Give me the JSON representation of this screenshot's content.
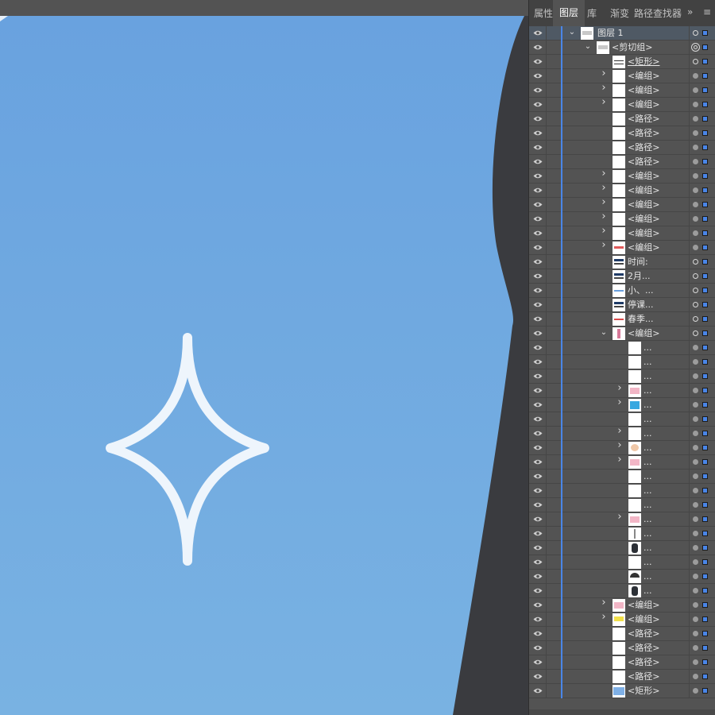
{
  "colors": {
    "canvas_dark": "#3a3b3f",
    "art_top": "#69a2df",
    "art_bottom": "#79b2e2",
    "star": "#eef5fc",
    "panel_bg": "#535353",
    "tab_bar_bg": "#424242",
    "selected_row": "#4f5964",
    "layer_color": "#4a86e8"
  },
  "canvas": {
    "star_icon": "four-point-star-outline"
  },
  "panel": {
    "tabs": [
      {
        "label": "属性",
        "active": false
      },
      {
        "label": "图层",
        "active": true
      },
      {
        "label": "库",
        "active": false
      },
      {
        "label": "渐变",
        "active": false
      },
      {
        "label": "路径查找器",
        "active": false
      }
    ],
    "overflow_glyph": "»",
    "menu_glyph": "≡",
    "rows": [
      {
        "indent": 0,
        "twisty": "open",
        "label": "图层 1",
        "thumb": "layer",
        "target": "outline",
        "selected": true
      },
      {
        "indent": 1,
        "twisty": "open",
        "label": "<剪切组>",
        "thumb": "layer",
        "target": "double"
      },
      {
        "indent": 2,
        "twisty": "",
        "label": "<矩形>",
        "thumb": "rect-line",
        "target": "outline",
        "underline": true
      },
      {
        "indent": 2,
        "twisty": "closed",
        "label": "<编组>",
        "thumb": "blank",
        "target": "fill"
      },
      {
        "indent": 2,
        "twisty": "closed",
        "label": "<编组>",
        "thumb": "blank",
        "target": "fill"
      },
      {
        "indent": 2,
        "twisty": "closed",
        "label": "<编组>",
        "thumb": "blank",
        "target": "fill"
      },
      {
        "indent": 2,
        "twisty": "",
        "label": "<路径>",
        "thumb": "blank",
        "target": "fill"
      },
      {
        "indent": 2,
        "twisty": "",
        "label": "<路径>",
        "thumb": "blank",
        "target": "fill"
      },
      {
        "indent": 2,
        "twisty": "",
        "label": "<路径>",
        "thumb": "blank",
        "target": "fill"
      },
      {
        "indent": 2,
        "twisty": "",
        "label": "<路径>",
        "thumb": "blank",
        "target": "fill"
      },
      {
        "indent": 2,
        "twisty": "closed",
        "label": "<编组>",
        "thumb": "blank",
        "target": "fill"
      },
      {
        "indent": 2,
        "twisty": "closed",
        "label": "<编组>",
        "thumb": "blank",
        "target": "fill"
      },
      {
        "indent": 2,
        "twisty": "closed",
        "label": "<编组>",
        "thumb": "blank",
        "target": "fill"
      },
      {
        "indent": 2,
        "twisty": "closed",
        "label": "<编组>",
        "thumb": "blank",
        "target": "fill"
      },
      {
        "indent": 2,
        "twisty": "closed",
        "label": "<编组>",
        "thumb": "blank",
        "target": "fill"
      },
      {
        "indent": 2,
        "twisty": "closed",
        "label": "<编组>",
        "thumb": "red-mark",
        "target": "fill"
      },
      {
        "indent": 2,
        "twisty": "",
        "label": "时间:",
        "thumb": "dark-text",
        "target": "outline"
      },
      {
        "indent": 2,
        "twisty": "",
        "label": "2月...",
        "thumb": "dark-text",
        "target": "outline"
      },
      {
        "indent": 2,
        "twisty": "",
        "label": "小、...",
        "thumb": "blue-text",
        "target": "outline"
      },
      {
        "indent": 2,
        "twisty": "",
        "label": "停课...",
        "thumb": "dark-text",
        "target": "outline"
      },
      {
        "indent": 2,
        "twisty": "",
        "label": "春季...",
        "thumb": "red-text",
        "target": "outline"
      },
      {
        "indent": 2,
        "twisty": "open",
        "label": "<编组>",
        "thumb": "figure",
        "target": "outline"
      },
      {
        "indent": 3,
        "twisty": "",
        "label": "...",
        "thumb": "blank",
        "target": "fill"
      },
      {
        "indent": 3,
        "twisty": "",
        "label": "...",
        "thumb": "blank",
        "target": "fill"
      },
      {
        "indent": 3,
        "twisty": "",
        "label": "...",
        "thumb": "blank",
        "target": "fill"
      },
      {
        "indent": 3,
        "twisty": "closed",
        "label": "...",
        "thumb": "pink",
        "target": "fill"
      },
      {
        "indent": 3,
        "twisty": "closed",
        "label": "...",
        "thumb": "blue-shape",
        "target": "fill"
      },
      {
        "indent": 3,
        "twisty": "",
        "label": "...",
        "thumb": "blank",
        "target": "fill"
      },
      {
        "indent": 3,
        "twisty": "closed",
        "label": "...",
        "thumb": "blank",
        "target": "fill"
      },
      {
        "indent": 3,
        "twisty": "closed",
        "label": "...",
        "thumb": "face",
        "target": "fill"
      },
      {
        "indent": 3,
        "twisty": "closed",
        "label": "...",
        "thumb": "pink",
        "target": "fill"
      },
      {
        "indent": 3,
        "twisty": "",
        "label": "...",
        "thumb": "blank",
        "target": "fill"
      },
      {
        "indent": 3,
        "twisty": "",
        "label": "...",
        "thumb": "blank",
        "target": "fill"
      },
      {
        "indent": 3,
        "twisty": "",
        "label": "...",
        "thumb": "blank",
        "target": "fill"
      },
      {
        "indent": 3,
        "twisty": "closed",
        "label": "...",
        "thumb": "pink",
        "target": "fill"
      },
      {
        "indent": 3,
        "twisty": "",
        "label": "...",
        "thumb": "line",
        "target": "fill"
      },
      {
        "indent": 3,
        "twisty": "",
        "label": "...",
        "thumb": "dark-shape",
        "target": "fill"
      },
      {
        "indent": 3,
        "twisty": "",
        "label": "...",
        "thumb": "blank",
        "target": "fill"
      },
      {
        "indent": 3,
        "twisty": "",
        "label": "...",
        "thumb": "arc",
        "target": "fill"
      },
      {
        "indent": 3,
        "twisty": "",
        "label": "...",
        "thumb": "dark-shape",
        "target": "fill"
      },
      {
        "indent": 2,
        "twisty": "closed",
        "label": "<编组>",
        "thumb": "pink",
        "target": "fill"
      },
      {
        "indent": 2,
        "twisty": "closed",
        "label": "<编组>",
        "thumb": "yellow",
        "target": "fill"
      },
      {
        "indent": 2,
        "twisty": "",
        "label": "<路径>",
        "thumb": "blank",
        "target": "fill"
      },
      {
        "indent": 2,
        "twisty": "",
        "label": "<路径>",
        "thumb": "blank",
        "target": "fill"
      },
      {
        "indent": 2,
        "twisty": "",
        "label": "<路径>",
        "thumb": "blank",
        "target": "fill"
      },
      {
        "indent": 2,
        "twisty": "",
        "label": "<路径>",
        "thumb": "blank",
        "target": "fill"
      },
      {
        "indent": 2,
        "twisty": "",
        "label": "<矩形>",
        "thumb": "gradient",
        "target": "fill"
      }
    ]
  }
}
